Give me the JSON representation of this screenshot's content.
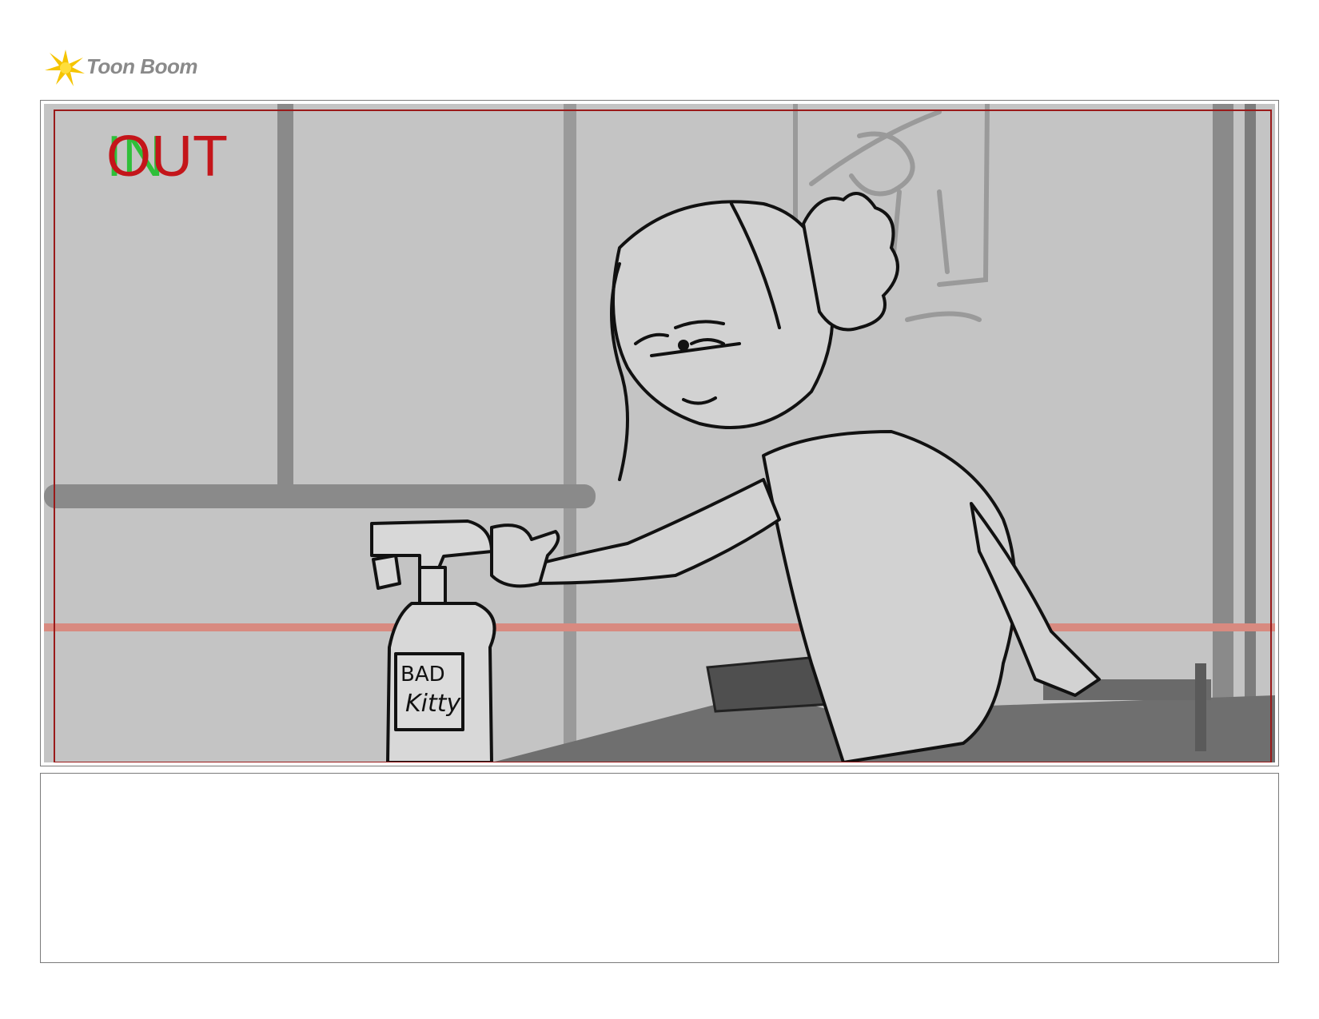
{
  "brand": {
    "name": "Toon Boom",
    "logo_color": "#f5c400"
  },
  "panel": {
    "in_marker": "IN",
    "out_marker": "OUT",
    "in_color": "#2fbf3a",
    "out_color": "#c4151a",
    "bottle_label_line1": "BAD",
    "bottle_label_line2": "Kitty"
  },
  "notes": {
    "text": ""
  }
}
